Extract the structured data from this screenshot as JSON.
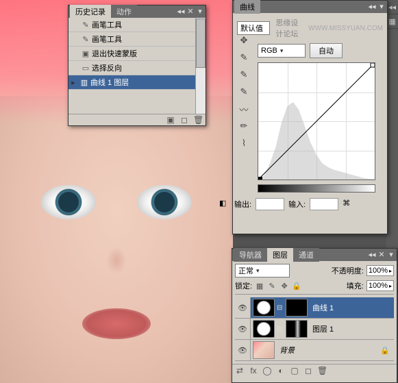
{
  "watermark": "WWW.MISSYUAN.COM",
  "watermark2": "思缘设计论坛",
  "history": {
    "tabs": [
      "历史记录",
      "动作"
    ],
    "items": [
      {
        "icon": "brush",
        "label": "画笔工具"
      },
      {
        "icon": "brush",
        "label": "画笔工具"
      },
      {
        "icon": "mask",
        "label": "退出快速蒙版"
      },
      {
        "icon": "select",
        "label": "选择反向"
      },
      {
        "icon": "layer",
        "label": "曲线 1 图层"
      }
    ]
  },
  "curves": {
    "title": "曲线",
    "preset_label": "",
    "preset_value": "默认值",
    "channel": "RGB",
    "auto_btn": "自动",
    "output_label": "输出:",
    "input_label": "输入:"
  },
  "layers": {
    "tabs": [
      "导航器",
      "图层",
      "通道"
    ],
    "blend_mode": "正常",
    "opacity_label": "不透明度:",
    "opacity_value": "100%",
    "lock_label": "锁定:",
    "fill_label": "填充:",
    "fill_value": "100%",
    "items": [
      {
        "name": "曲线 1",
        "type": "adj",
        "selected": true
      },
      {
        "name": "图层 1",
        "type": "adj",
        "selected": false
      },
      {
        "name": "背景",
        "type": "bg",
        "selected": false
      }
    ]
  }
}
